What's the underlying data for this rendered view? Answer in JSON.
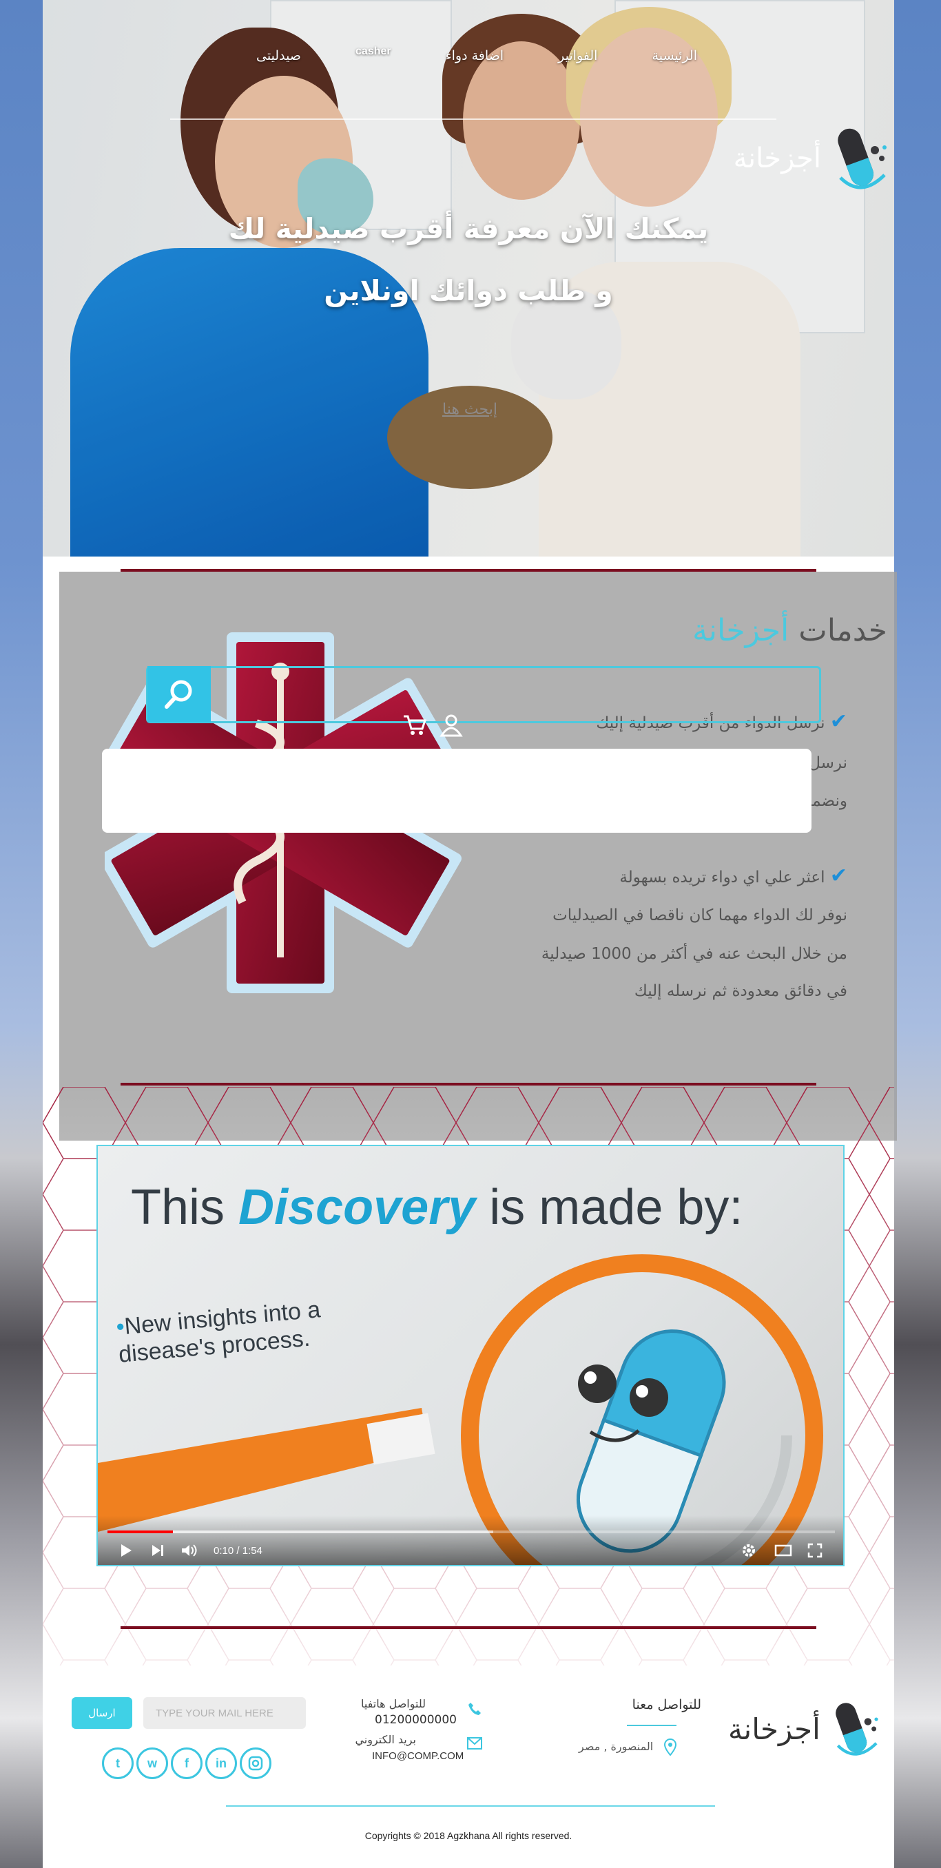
{
  "nav": {
    "items": [
      "الرئيسية",
      "الفواتير",
      "اضافة دواء",
      "casher",
      "صيدليتى"
    ]
  },
  "brand": {
    "name": "أجزخانة"
  },
  "hero": {
    "line1": "يمكنك الآن معرفة أقرب صيدلية لك",
    "line2": "و طلب دوائك اونلاين",
    "link": "إبحث هنا"
  },
  "services": {
    "title_plain": "خدمات",
    "title_accent": "أجزخانة",
    "block1": [
      "نرسل الدواء من أقرب صيدلية إليك",
      "نرسل طلبك",
      "ونضمن لك"
    ],
    "block2": [
      "اعثر علي اي دواء تريده بسهولة",
      "نوفر لك الدواء مهما كان ناقصا في الصيدليات",
      "من خلال البحث عنه في أكثر من 1000 صيدلية",
      "في دقائق معدودة ثم نرسله إليك"
    ]
  },
  "video": {
    "title_before": "This",
    "title_accent": "Discovery",
    "title_after": "is made by:",
    "bullet_line1": "New insights into a",
    "bullet_line2": "disease's process.",
    "time": "0:10 / 1:54",
    "progress_fraction": 0.09,
    "buffered_fraction": 0.53
  },
  "footer": {
    "contact_heading": "للتواصل معنا",
    "address": "المنصورة , مصر",
    "phone_label": "للتواصل هاتفيا",
    "phone": "01200000000",
    "email_label": "بريد الكتروني",
    "email": "INFO@COMP.COM",
    "mail_placeholder": "TYPE YOUR MAIL HERE",
    "send_label": "ارسال",
    "socials": [
      "twitter-icon",
      "whatsapp-icon",
      "facebook-icon",
      "linkedin-icon",
      "instagram-icon"
    ],
    "copyright": "Copyrights © 2018 Agzkhana All rights reserved."
  },
  "colors": {
    "accent": "#4cc9de",
    "dark_red": "#7b0d20",
    "check_blue": "#1e8fd8"
  }
}
